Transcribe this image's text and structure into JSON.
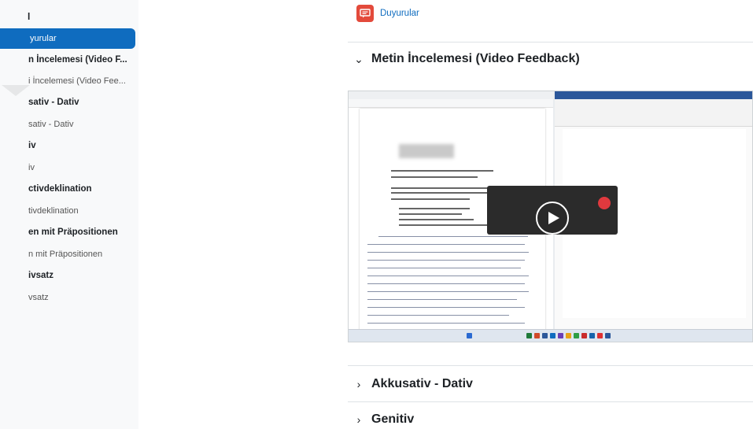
{
  "sidebar": {
    "title": "l",
    "items": [
      {
        "label": "yurular",
        "kind": "activity",
        "active": true
      },
      {
        "label": "n İncelemesi (Video F...",
        "kind": "section"
      },
      {
        "label": "i İncelemesi (Video Fee...",
        "kind": "activity"
      },
      {
        "label": "sativ - Dativ",
        "kind": "section"
      },
      {
        "label": "sativ - Dativ",
        "kind": "activity"
      },
      {
        "label": "iv",
        "kind": "section"
      },
      {
        "label": "iv",
        "kind": "activity"
      },
      {
        "label": "ctivdeklination",
        "kind": "section"
      },
      {
        "label": "tivdeklination",
        "kind": "activity"
      },
      {
        "label": "en mit Präpositionen",
        "kind": "section"
      },
      {
        "label": "n mit Präpositionen",
        "kind": "activity"
      },
      {
        "label": "ivsatz",
        "kind": "section"
      },
      {
        "label": "vsatz",
        "kind": "activity"
      }
    ]
  },
  "main": {
    "announcements": {
      "label": "Duyurular",
      "icon": "announcement-icon"
    },
    "sections": [
      {
        "title": "Metin İncelemesi (Video Feedback)",
        "expanded": true
      },
      {
        "title": "Akkusativ - Dativ",
        "expanded": false
      },
      {
        "title": "Genitiv",
        "expanded": false
      }
    ],
    "video": {
      "play_icon": "play-icon",
      "record_icon": "record-icon"
    }
  },
  "colors": {
    "accent": "#0f6cbf",
    "announcement_icon_bg": "#e34a3b",
    "record": "#e0393e"
  }
}
